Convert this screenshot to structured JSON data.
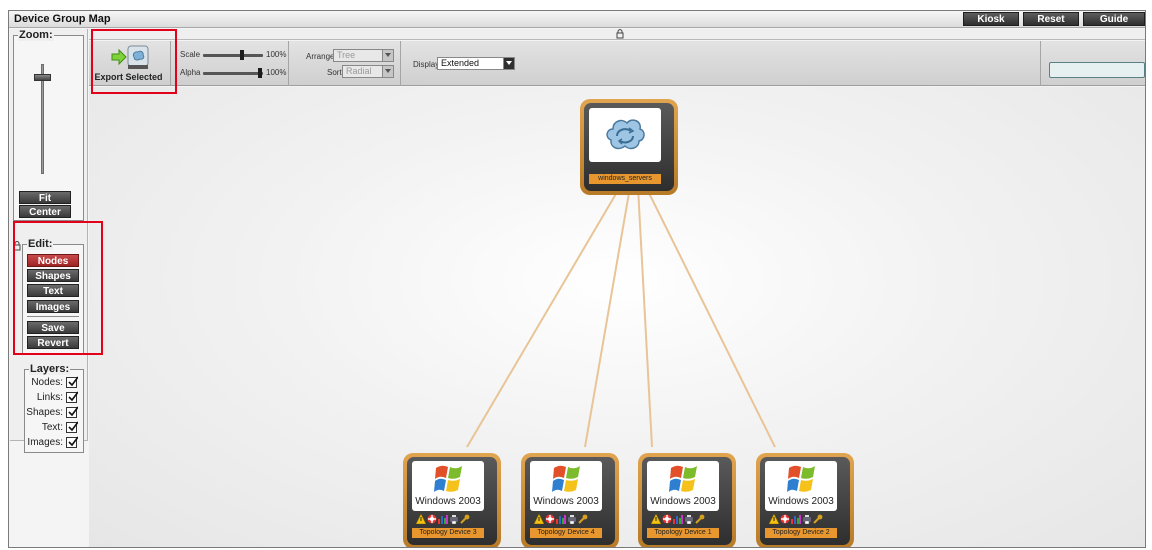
{
  "window": {
    "title": "Device Group Map",
    "buttons": [
      "Kiosk",
      "Reset",
      "Guide"
    ]
  },
  "left_panel": {
    "zoom": {
      "legend": "Zoom:",
      "fit": "Fit",
      "center": "Center"
    },
    "edit": {
      "legend": "Edit:",
      "buttons": [
        "Nodes",
        "Shapes",
        "Text",
        "Images",
        "Save",
        "Revert"
      ],
      "active": "Nodes"
    },
    "layers": {
      "legend": "Layers:",
      "items": [
        {
          "label": "Nodes:",
          "checked": true
        },
        {
          "label": "Links:",
          "checked": true
        },
        {
          "label": "Shapes:",
          "checked": true
        },
        {
          "label": "Text:",
          "checked": true
        },
        {
          "label": "Images:",
          "checked": true
        }
      ]
    }
  },
  "toolbar": {
    "export_label": "Export Selected",
    "scale_label": "Scale",
    "scale_value": "100%",
    "alpha_label": "Alpha",
    "alpha_value": "100%",
    "arrange_label": "Arrange",
    "arrange_value": "Tree",
    "sort_label": "Sort",
    "sort_value": "Radial",
    "display_label": "Display",
    "display_value": "Extended",
    "search_value": ""
  },
  "map": {
    "root": {
      "label": "windows_servers",
      "icon": "cloud-icon"
    },
    "children": [
      {
        "label": "Topology Device 3",
        "os_text": "Windows 2003"
      },
      {
        "label": "Topology Device 4",
        "os_text": "Windows 2003"
      },
      {
        "label": "Topology Device 1",
        "os_text": "Windows 2003"
      },
      {
        "label": "Topology Device 2",
        "os_text": "Windows 2003"
      }
    ],
    "link_color": "#e9c497",
    "node_color": "#d99236"
  },
  "colors": {
    "highlight": "#e3001b",
    "active_button": "#b83434"
  }
}
